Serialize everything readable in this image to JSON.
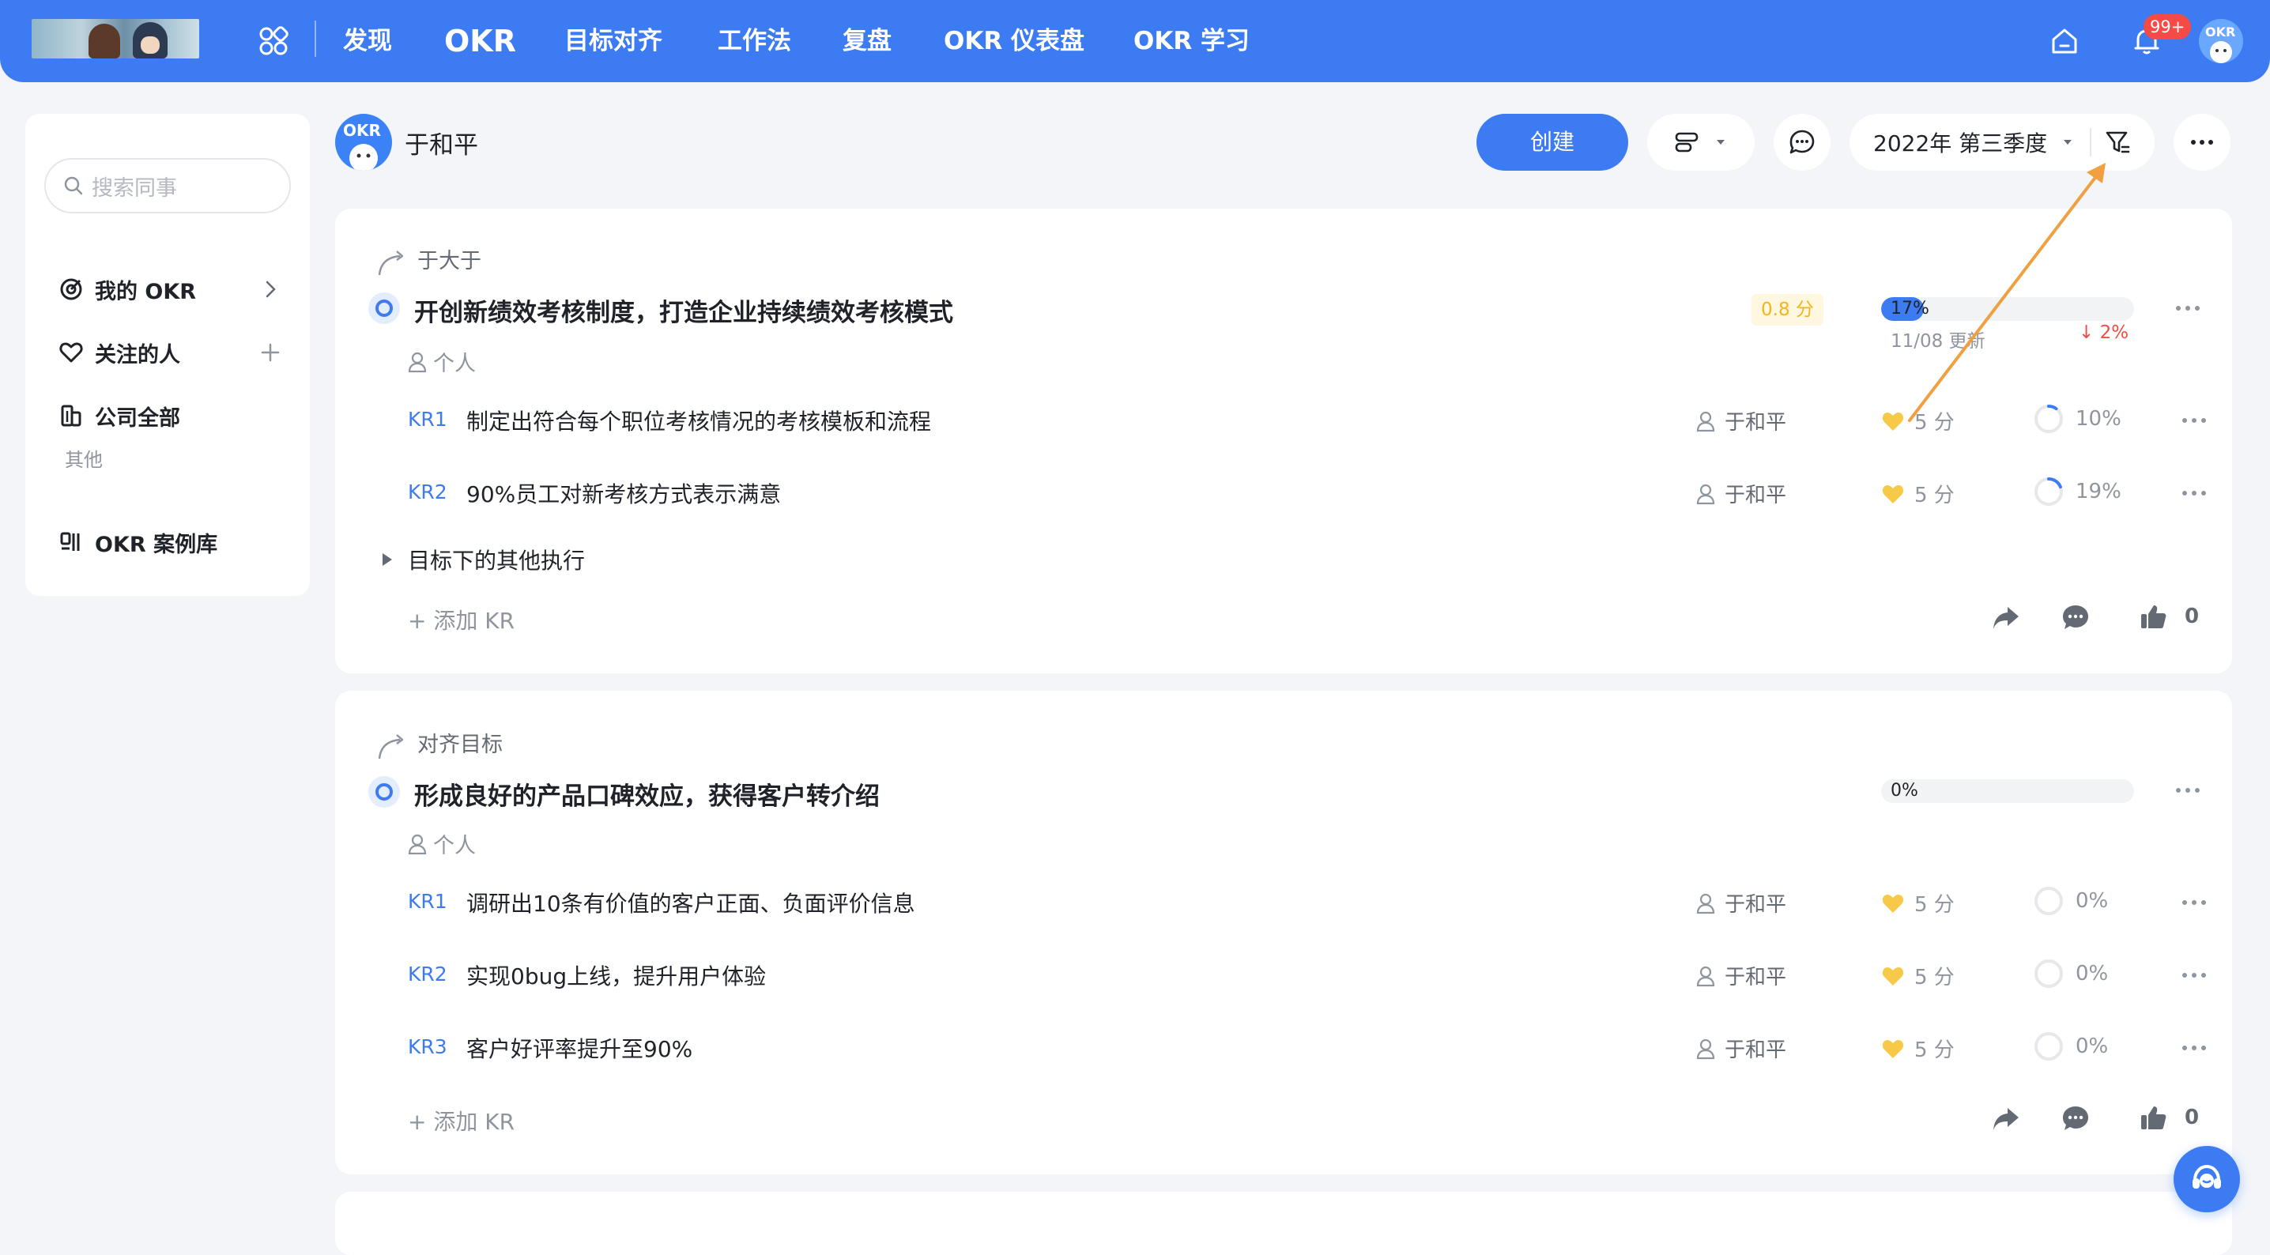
{
  "nav": {
    "items": [
      "发现",
      "OKR",
      "目标对齐",
      "工作法",
      "复盘",
      "OKR 仪表盘",
      "OKR 学习"
    ],
    "active": "OKR",
    "notification_badge": "99+",
    "avatar_text": "OKR"
  },
  "sidebar": {
    "search_placeholder": "搜索同事",
    "items": [
      {
        "label": "我的 OKR",
        "icon": "target-icon"
      },
      {
        "label": "关注的人",
        "icon": "heart-icon"
      },
      {
        "label": "公司全部",
        "icon": "building-icon"
      }
    ],
    "other_header": "其他",
    "case_library": {
      "label": "OKR 案例库",
      "icon": "library-icon"
    }
  },
  "header": {
    "avatar_text": "OKR",
    "owner": "于和平",
    "create_label": "创建",
    "quarter": "2022年 第三季度"
  },
  "objectives": [
    {
      "align_label": "于大于",
      "title": "开创新绩效考核制度，打造企业持续绩效考核模式",
      "personal": "个人",
      "score": "0.8 分",
      "progress": 0.17,
      "progress_text": "17%",
      "update_note": "11/08 更新",
      "delta": "↓ 2%",
      "krs": [
        {
          "label": "KR1",
          "text": "制定出符合每个职位考核情况的考核模板和流程",
          "owner": "于和平",
          "score": "5 分",
          "progress": 0.1,
          "progress_text": "10%"
        },
        {
          "label": "KR2",
          "text": "90%员工对新考核方式表示满意",
          "owner": "于和平",
          "score": "5 分",
          "progress": 0.19,
          "progress_text": "19%"
        }
      ],
      "other_exec": "目标下的其他执行",
      "add_kr": "+ 添加 KR",
      "likes": "0"
    },
    {
      "align_label": "对齐目标",
      "title": "形成良好的产品口碑效应，获得客户转介绍",
      "personal": "个人",
      "progress": 0.0,
      "progress_text": "0%",
      "krs": [
        {
          "label": "KR1",
          "text": "调研出10条有价值的客户正面、负面评价信息",
          "owner": "于和平",
          "score": "5 分",
          "progress": 0.0,
          "progress_text": "0%"
        },
        {
          "label": "KR2",
          "text": "实现0bug上线，提升用户体验",
          "owner": "于和平",
          "score": "5 分",
          "progress": 0.0,
          "progress_text": "0%"
        },
        {
          "label": "KR3",
          "text": "客户好评率提升至90%",
          "owner": "于和平",
          "score": "5 分",
          "progress": 0.0,
          "progress_text": "0%"
        }
      ],
      "add_kr": "+ 添加 KR",
      "likes": "0"
    }
  ],
  "colors": {
    "brand": "#3c7bf2",
    "annotation_arrow": "#f0a040",
    "score": "#f2b51c",
    "down": "#f54a45"
  }
}
